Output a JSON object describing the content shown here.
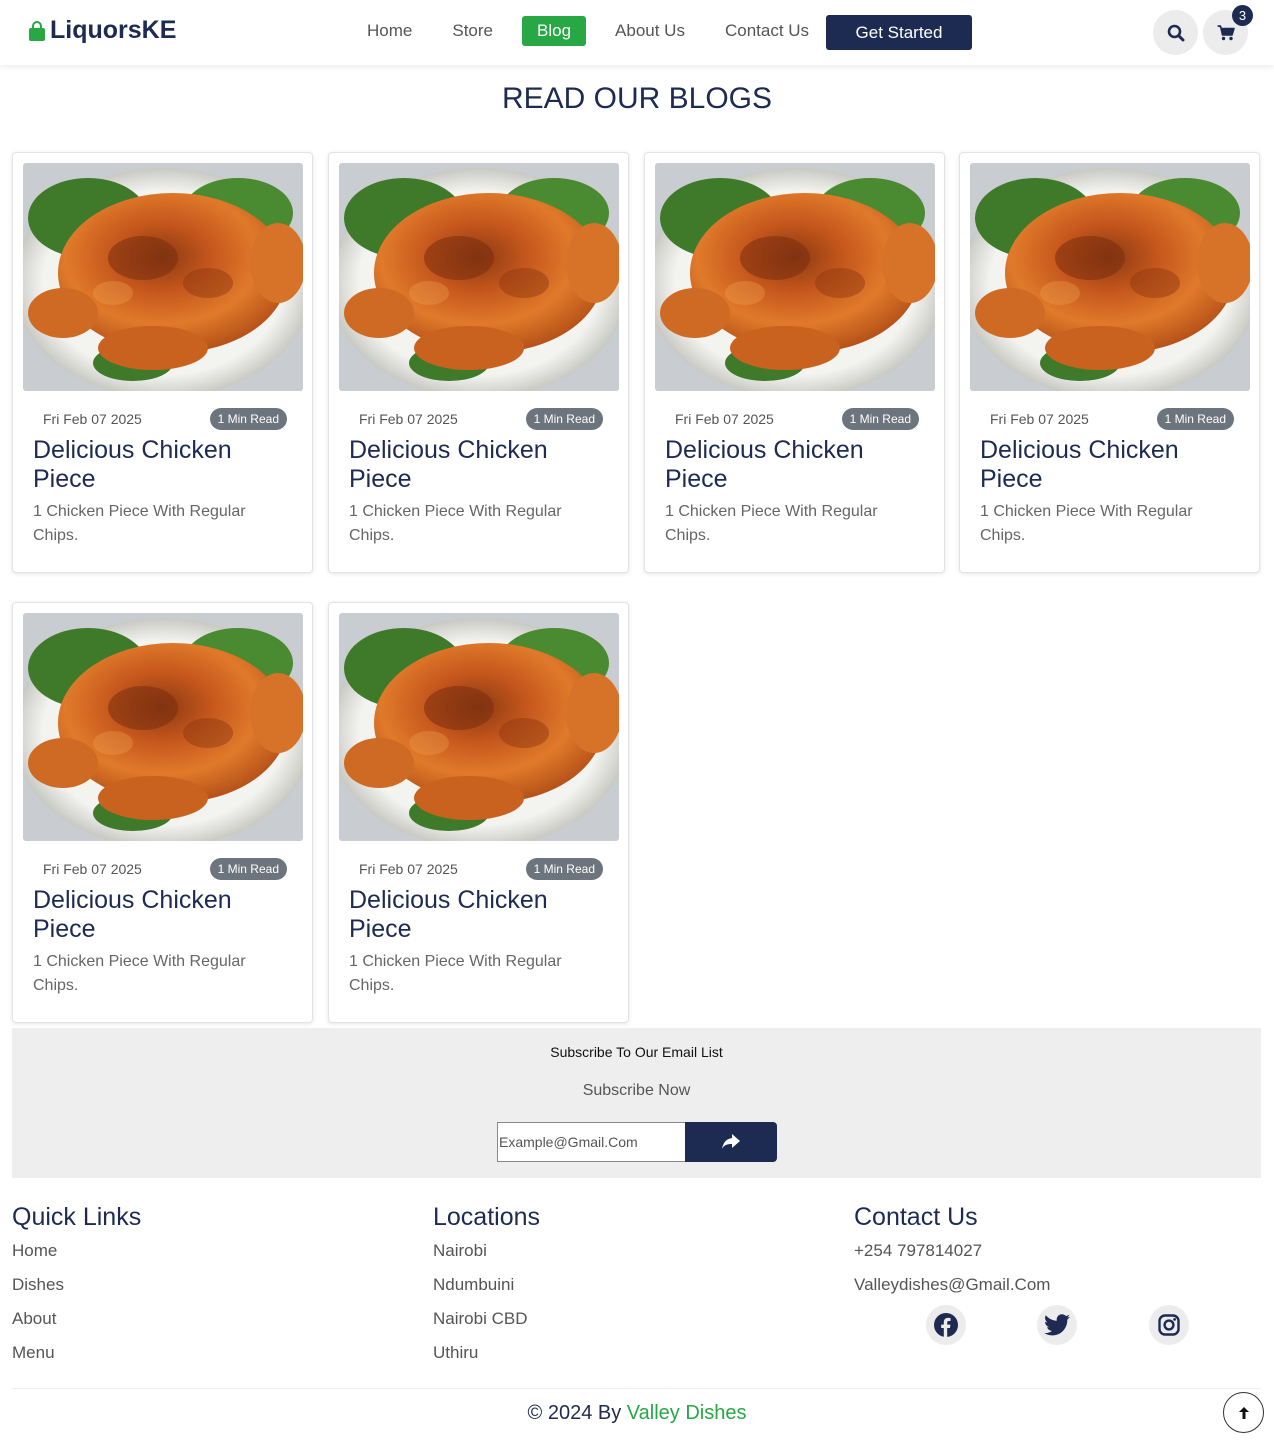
{
  "header": {
    "brand": "LiquorsKE",
    "nav": [
      {
        "label": "Home",
        "active": false
      },
      {
        "label": "Store",
        "active": false
      },
      {
        "label": "Blog",
        "active": true
      },
      {
        "label": "About Us",
        "active": false
      },
      {
        "label": "Contact Us",
        "active": false
      }
    ],
    "cta_label": "Get Started",
    "search_icon": "search-icon",
    "cart_icon": "cart-icon",
    "cart_count": "3"
  },
  "page_title": "READ OUR BLOGS",
  "posts": [
    {
      "date": "Fri Feb 07 2025",
      "read_time": "1 Min Read",
      "title": "Delicious Chicken Piece",
      "description": "1 Chicken Piece With Regular Chips."
    },
    {
      "date": "Fri Feb 07 2025",
      "read_time": "1 Min Read",
      "title": "Delicious Chicken Piece",
      "description": "1 Chicken Piece With Regular Chips."
    },
    {
      "date": "Fri Feb 07 2025",
      "read_time": "1 Min Read",
      "title": "Delicious Chicken Piece",
      "description": "1 Chicken Piece With Regular Chips."
    },
    {
      "date": "Fri Feb 07 2025",
      "read_time": "1 Min Read",
      "title": "Delicious Chicken Piece",
      "description": "1 Chicken Piece With Regular Chips."
    },
    {
      "date": "Fri Feb 07 2025",
      "read_time": "1 Min Read",
      "title": "Delicious Chicken Piece",
      "description": "1 Chicken Piece With Regular Chips."
    },
    {
      "date": "Fri Feb 07 2025",
      "read_time": "1 Min Read",
      "title": "Delicious Chicken Piece",
      "description": "1 Chicken Piece With Regular Chips."
    }
  ],
  "subscribe": {
    "title": "Subscribe To Our Email List",
    "subtitle": "Subscribe Now",
    "placeholder": "Example@Gmail.Com",
    "button_icon": "share-arrow-icon"
  },
  "footer": {
    "quick_links": {
      "heading": "Quick Links",
      "items": [
        "Home",
        "Dishes",
        "About",
        "Menu"
      ]
    },
    "locations": {
      "heading": "Locations",
      "items": [
        "Nairobi",
        "Ndumbuini",
        "Nairobi CBD",
        "Uthiru"
      ]
    },
    "contact": {
      "heading": "Contact Us",
      "phone": "+254 797814027",
      "email": "Valleydishes@Gmail.Com"
    },
    "social_icons": [
      "facebook-icon",
      "twitter-icon",
      "instagram-icon"
    ],
    "copyright_prefix": "© 2024 By",
    "copyright_brand": "Valley Dishes",
    "back_to_top_icon": "arrow-up-icon"
  },
  "colors": {
    "brand_navy": "#1d2b53",
    "accent_green": "#28a745",
    "badge_gray": "#6c757d"
  }
}
